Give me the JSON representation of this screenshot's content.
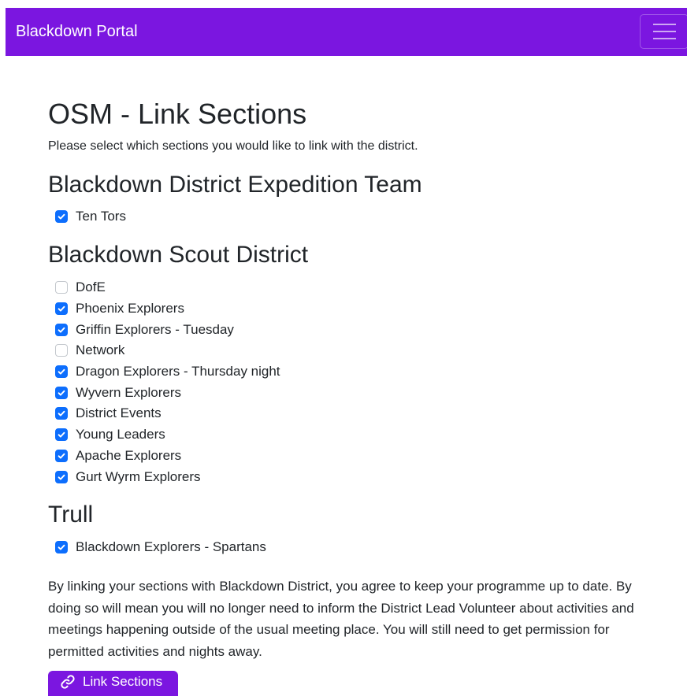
{
  "navbar": {
    "brand": "Blackdown Portal",
    "menu_icon": "hamburger-menu-icon"
  },
  "page": {
    "title": "OSM - Link Sections",
    "intro": "Please select which sections you would like to link with the district."
  },
  "groups": [
    {
      "name": "Blackdown District Expedition Team",
      "sections": [
        {
          "label": "Ten Tors",
          "checked": true
        }
      ]
    },
    {
      "name": "Blackdown Scout District",
      "sections": [
        {
          "label": "DofE",
          "checked": false
        },
        {
          "label": "Phoenix Explorers",
          "checked": true
        },
        {
          "label": "Griffin Explorers - Tuesday",
          "checked": true
        },
        {
          "label": "Network",
          "checked": false
        },
        {
          "label": "Dragon Explorers - Thursday night",
          "checked": true
        },
        {
          "label": "Wyvern Explorers",
          "checked": true
        },
        {
          "label": "District Events",
          "checked": true
        },
        {
          "label": "Young Leaders",
          "checked": true
        },
        {
          "label": "Apache Explorers",
          "checked": true
        },
        {
          "label": "Gurt Wyrm Explorers",
          "checked": true
        }
      ]
    },
    {
      "name": "Trull",
      "sections": [
        {
          "label": "Blackdown Explorers - Spartans",
          "checked": true
        }
      ]
    }
  ],
  "agreement": "By linking your sections with Blackdown District, you agree to keep your programme up to date. By doing so will mean you will no longer need to inform the District Lead Volunteer about activities and meetings happening outside of the usual meeting place. You will still need to get permission for permitted activities and nights away.",
  "button": {
    "label": "Link Sections",
    "icon": "link-icon"
  },
  "colors": {
    "brand": "#7b16e0",
    "checkbox_checked": "#0d6efd"
  }
}
